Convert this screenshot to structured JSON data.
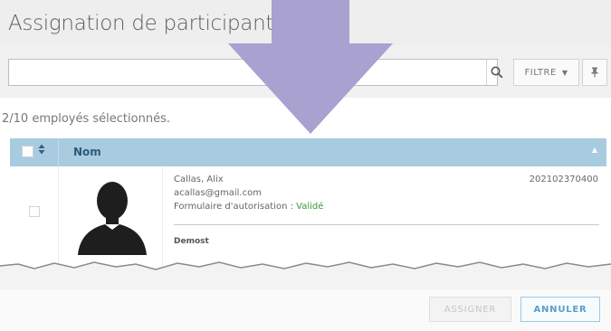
{
  "dialog": {
    "title": "Assignation de participants"
  },
  "toolbar": {
    "search_value": "",
    "search_icon": "search-icon",
    "filter_label": "FILTRE",
    "filter_caret": "▼",
    "pin_icon": "pin-icon"
  },
  "selection": {
    "summary": "2/10 employés sélectionnés."
  },
  "table": {
    "sort_icon": "sort-icon",
    "column_name": "Nom",
    "collapse_icon": "▲",
    "rows": [
      {
        "name": "Callas, Alix",
        "email": "acallas@gmail.com",
        "form_label": "Formulaire d'autorisation : ",
        "form_status": "Validé",
        "employee_id": "202102370400",
        "group": "Demost",
        "checked": false
      }
    ]
  },
  "footer": {
    "assign_label": "ASSIGNER",
    "cancel_label": "ANNULER"
  },
  "colors": {
    "header_bg": "#a9cbe0",
    "status_valid": "#3a9a3a",
    "arrow": "#a9a1cf",
    "cancel_accent": "#5b9fc6"
  }
}
